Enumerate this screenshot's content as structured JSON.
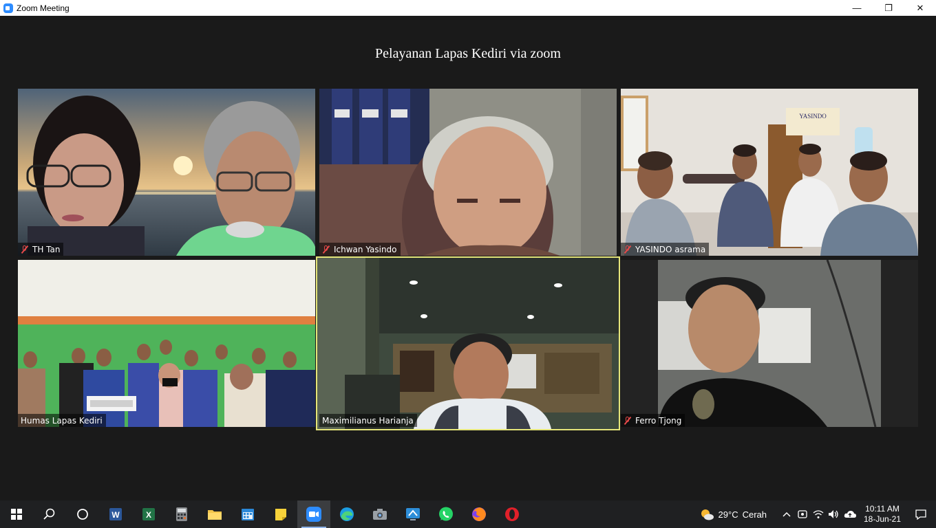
{
  "window": {
    "title": "Zoom Meeting",
    "minimize": "—",
    "restore": "❐",
    "close": "✕"
  },
  "meeting": {
    "title": "Pelayanan Lapas Kediri via zoom"
  },
  "participants": [
    {
      "name": "TH Tan",
      "muted": true
    },
    {
      "name": "Ichwan Yasindo",
      "muted": true
    },
    {
      "name": "YASINDO asrama",
      "muted": true
    },
    {
      "name": "Humas Lapas Kediri",
      "muted": false
    },
    {
      "name": "Maximilianus Harianja",
      "muted": false,
      "active_speaker": true
    },
    {
      "name": "Ferro Tjong",
      "muted": true
    }
  ],
  "tile_texts": {
    "yasindo_sign": "YASINDO"
  },
  "taskbar": {
    "weather_temp": "29°C",
    "weather_desc": "Cerah",
    "time": "10:11 AM",
    "date": "18-Jun-21",
    "word_letter": "W",
    "excel_letter": "X"
  },
  "colors": {
    "zoom_blue": "#2d8cff",
    "active_outline": "#e6e67a",
    "muted_red": "#e84a4a",
    "taskbar": "#1f2022"
  }
}
